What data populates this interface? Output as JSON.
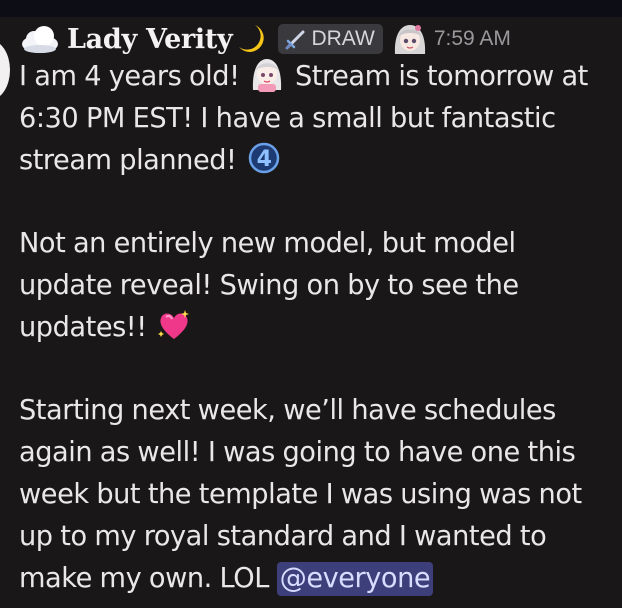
{
  "message": {
    "author": {
      "username": "Lady Verity",
      "prefix_icon": "cloud-icon",
      "suffix_icon": "crescent-moon-icon"
    },
    "tag": {
      "icon": "sword-icon",
      "label": "DRAW"
    },
    "author_avatar_icon": "anime-avatar-icon",
    "timestamp": "7:59 AM",
    "lines": {
      "l1a": "I am 4 years old!",
      "l1b": "Stream is tomorrow at",
      "l2": "6:30 PM EST! I have a small but fantastic",
      "l3": "stream planned!",
      "l5": "Not an entirely new model, but model",
      "l6": "update reveal! Swing on by to see the",
      "l7": "updates!!",
      "l9": "Starting next week, we’ll have schedules",
      "l10": "again as well! I was going to have one this",
      "l11": "week but the template I was using was not",
      "l12": "up to my royal standard and I wanted to",
      "l13": "make my own. LOL"
    },
    "mention": "@everyone",
    "emojis": {
      "e1": "anime-girl-emote",
      "e2": "number-four-icon",
      "e3": "sparkling-heart-icon"
    }
  }
}
